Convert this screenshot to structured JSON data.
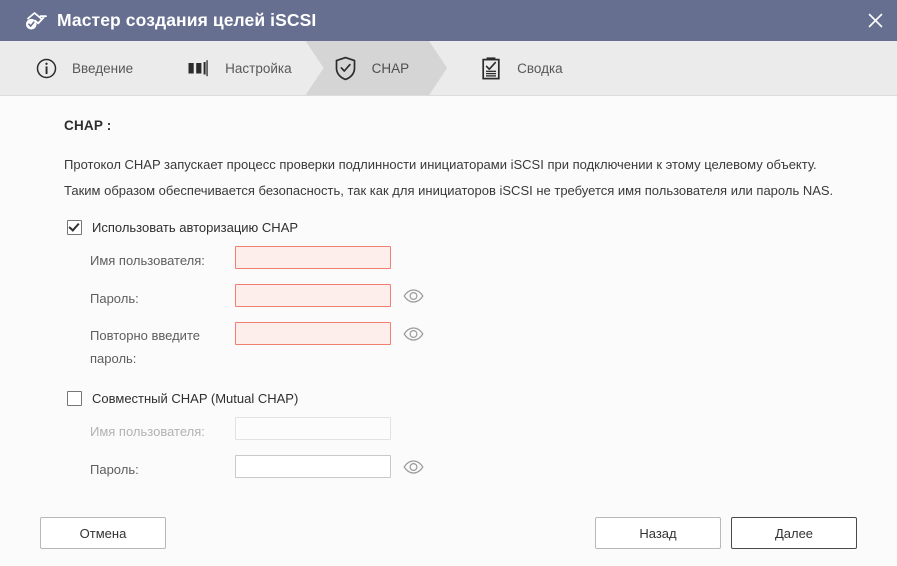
{
  "window": {
    "title": "Мастер создания целей iSCSI",
    "title_icon": "target-check-icon",
    "close_icon": "close-icon",
    "accent_color": "#676f91"
  },
  "steps": [
    {
      "label": "Введение",
      "icon": "info-circle-icon",
      "active": false
    },
    {
      "label": "Настройка",
      "icon": "lun-storage-icon",
      "active": false
    },
    {
      "label": "CHAP",
      "icon": "shield-check-icon",
      "active": true
    },
    {
      "label": "Сводка",
      "icon": "clipboard-check-icon",
      "active": false
    }
  ],
  "main": {
    "section_title": "CHAP :",
    "description": "Протокол CHAP запускает процесс проверки подлинности инициаторами iSCSI при подключении к этому целевому объекту. Таким образом обеспечивается безопасность, так как для инициаторов iSCSI не требуется имя пользователя или пароль NAS.",
    "chap": {
      "checkbox_label": "Использовать авторизацию CHAP",
      "checked": true,
      "fields": [
        {
          "label": "Имя пользователя:",
          "value": "",
          "error": true,
          "has_eye": false
        },
        {
          "label": "Пароль:",
          "value": "",
          "error": true,
          "has_eye": true
        },
        {
          "label": "Повторно введите пароль:",
          "value": "",
          "error": true,
          "has_eye": true
        }
      ]
    },
    "mutual_chap": {
      "checkbox_label": "Совместный CHAP (Mutual CHAP)",
      "checked": false,
      "fields": [
        {
          "label": "Имя пользователя:",
          "value": "",
          "disabled": true,
          "has_eye": false
        },
        {
          "label": "Пароль:",
          "value": "",
          "disabled": false,
          "has_eye": true
        }
      ]
    },
    "eye_icon": "eye-icon",
    "error_border_color": "#ef8071",
    "error_fill_color": "#fdeeec"
  },
  "footer": {
    "cancel_label": "Отмена",
    "back_label": "Назад",
    "next_label": "Далее"
  }
}
